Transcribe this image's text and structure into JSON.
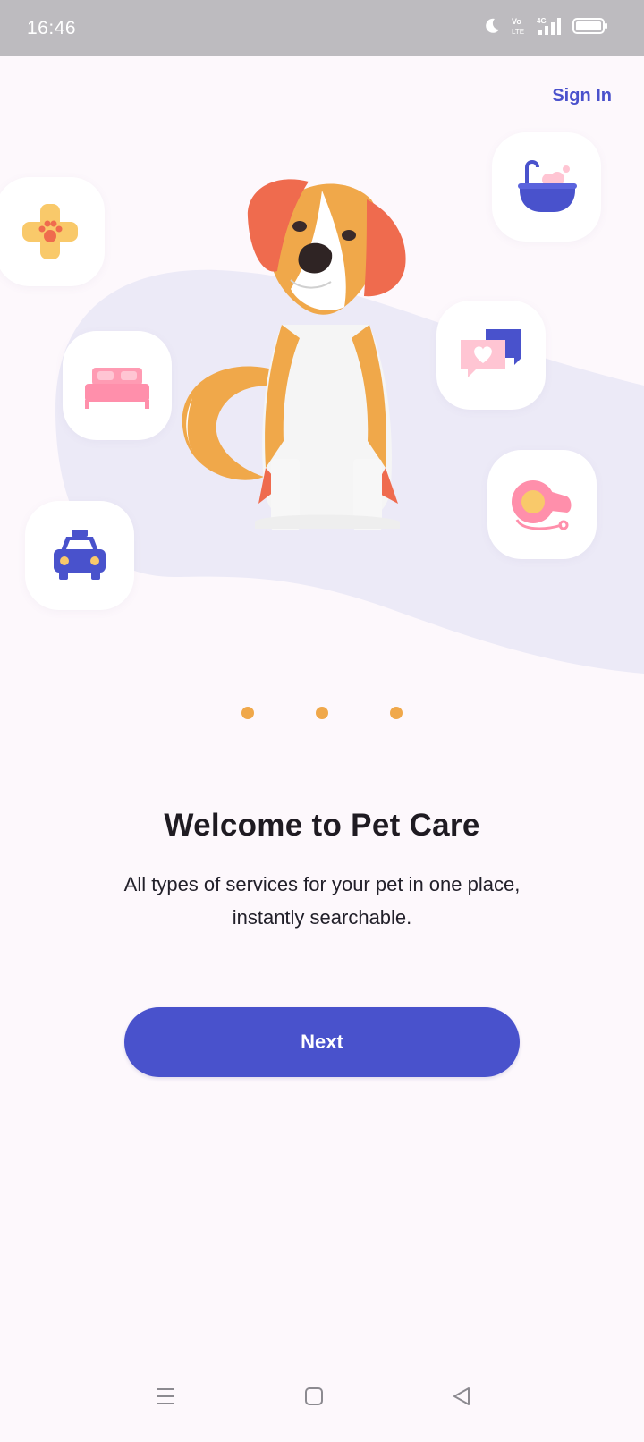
{
  "status_bar": {
    "time": "16:46",
    "icons": [
      "moon-icon",
      "volte-icon",
      "signal-4g-icon",
      "battery-icon"
    ],
    "volte_label": "Vo LTE",
    "network_label": "4G"
  },
  "header": {
    "sign_in_label": "Sign In"
  },
  "hero": {
    "tiles": [
      "medical-paw-icon",
      "bed-icon",
      "taxi-icon",
      "bath-icon",
      "chat-heart-icon",
      "leash-icon"
    ]
  },
  "pagination": {
    "count": 3,
    "active_index": 0
  },
  "content": {
    "title": "Welcome to Pet Care",
    "subtitle": "All types of services for your pet in one place, instantly searchable."
  },
  "actions": {
    "next_label": "Next"
  },
  "navigation_bar": {
    "items": [
      "menu-icon",
      "home-icon",
      "back-icon"
    ]
  },
  "colors": {
    "accent": "#4952cc",
    "dot": "#f0a84a",
    "background": "#fdf8fc",
    "wave": "#eceaf7"
  }
}
